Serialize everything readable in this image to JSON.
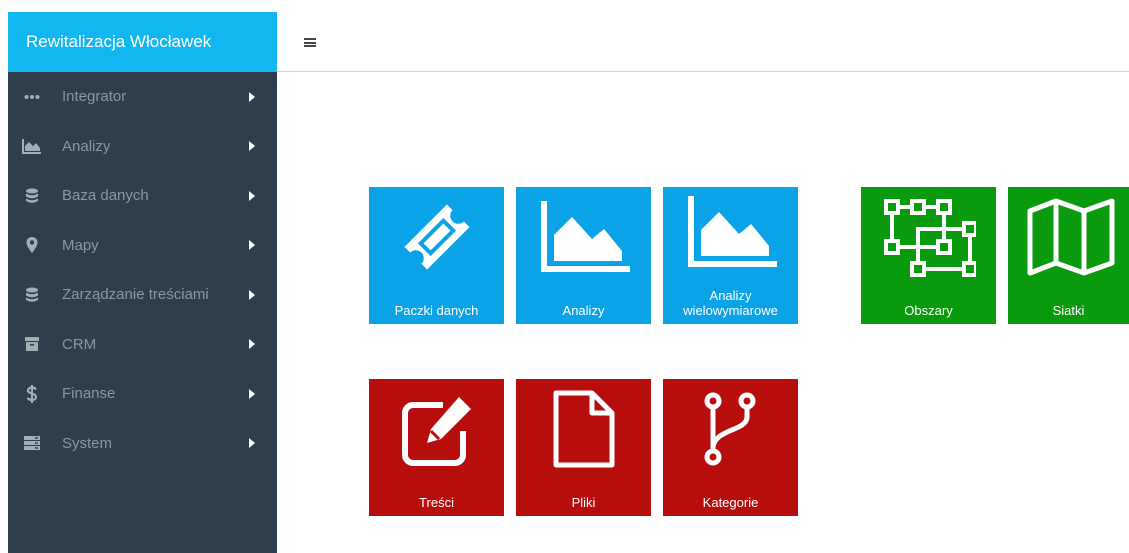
{
  "app": {
    "title": "Rewitalizacja Włocławek"
  },
  "sidebar": {
    "items": [
      {
        "label": "Integrator",
        "icon": "dots-icon"
      },
      {
        "label": "Analizy",
        "icon": "area-chart-icon"
      },
      {
        "label": "Baza danych",
        "icon": "database-icon"
      },
      {
        "label": "Mapy",
        "icon": "map-marker-icon"
      },
      {
        "label": "Zarządzanie treściami",
        "icon": "database-icon"
      },
      {
        "label": "CRM",
        "icon": "archive-icon"
      },
      {
        "label": "Finanse",
        "icon": "dollar-icon"
      },
      {
        "label": "System",
        "icon": "server-icon"
      }
    ]
  },
  "tiles": {
    "paczki": {
      "label": "Paczki danych",
      "icon": "ticket-icon"
    },
    "analizy": {
      "label": "Analizy",
      "icon": "area-chart-icon"
    },
    "analizy_w": {
      "label": "Analizy\nwielowymiarowe",
      "icon": "area-chart-icon"
    },
    "obszary": {
      "label": "Obszary",
      "icon": "object-group-icon"
    },
    "siatki": {
      "label": "Siatki",
      "icon": "map-icon"
    },
    "tresci": {
      "label": "Treści",
      "icon": "edit-icon"
    },
    "pliki": {
      "label": "Pliki",
      "icon": "file-icon"
    },
    "kategorie": {
      "label": "Kategorie",
      "icon": "code-fork-icon"
    }
  },
  "colors": {
    "sidebar_bg": "#2f3e4c",
    "brand_bg": "#12b6f0",
    "tile_blue": "#0aa3e8",
    "tile_green": "#0a9a0d",
    "tile_red": "#b80d0d"
  }
}
